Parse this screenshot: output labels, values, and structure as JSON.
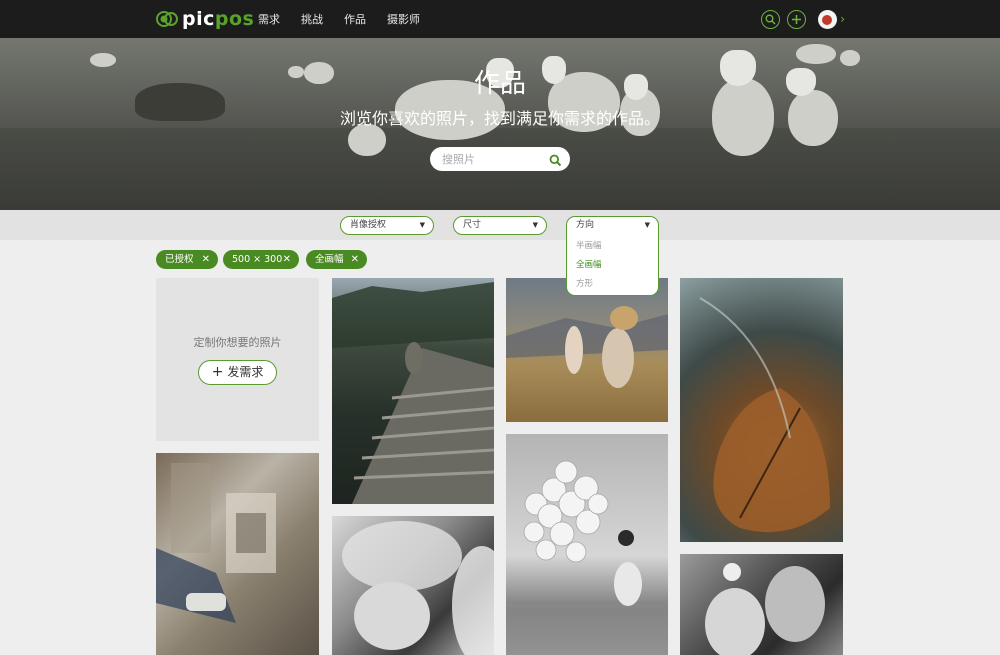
{
  "nav": {
    "logo_prefix": "pic",
    "logo_suffix": "pos",
    "items": [
      "需求",
      "挑战",
      "作品",
      "摄影师"
    ],
    "icons": [
      "search-icon",
      "plus-icon",
      "avatar",
      "chevron-right-icon"
    ]
  },
  "hero": {
    "title": "作品",
    "subtitle": "浏览你喜欢的照片，找到满足你需求的作品。",
    "search_placeholder": "搜照片"
  },
  "filters": {
    "portrait_rights": "肖像授权",
    "size": "尺寸",
    "orientation": {
      "label": "方向",
      "options": [
        "半画幅",
        "全画幅",
        "方形"
      ],
      "selected": "全画幅"
    }
  },
  "active_tags": [
    "已授权",
    "500 × 300",
    "全画幅"
  ],
  "cta": {
    "text": "定制你想要的照片",
    "button": "发需求"
  },
  "colors": {
    "accent": "#5a9a2e",
    "nav_bg": "#1c1c1c",
    "page_bg": "#eeeeee"
  }
}
